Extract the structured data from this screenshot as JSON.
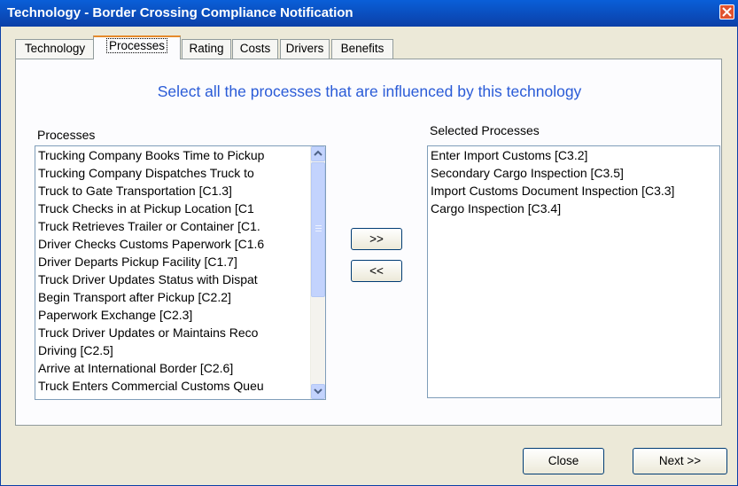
{
  "window": {
    "title": "Technology - Border Crossing Compliance Notification"
  },
  "tabs": [
    {
      "label": "Technology",
      "active": false
    },
    {
      "label": "Processes",
      "active": true
    },
    {
      "label": "Rating",
      "active": false
    },
    {
      "label": "Costs",
      "active": false
    },
    {
      "label": "Drivers",
      "active": false
    },
    {
      "label": "Benefits",
      "active": false
    }
  ],
  "main": {
    "instruction": "Select all the processes that are influenced by this technology",
    "processes_label": "Processes",
    "selected_label": "Selected Processes",
    "add_button": ">>",
    "remove_button": "<<",
    "processes": [
      "Trucking Company Books Time to Pickup",
      "Trucking Company Dispatches Truck to",
      "Truck to Gate Transportation [C1.3]",
      "Truck Checks in at Pickup Location [C1",
      "Truck Retrieves Trailer or Container [C1.",
      "Driver Checks Customs Paperwork [C1.6",
      "Driver Departs Pickup Facility [C1.7]",
      "Truck Driver Updates Status with Dispat",
      "Begin Transport after Pickup [C2.2]",
      "Paperwork Exchange [C2.3]",
      "Truck Driver Updates or Maintains Reco",
      "Driving [C2.5]",
      "Arrive at International Border [C2.6]",
      "Truck Enters Commercial Customs Queu"
    ],
    "selected": [
      "Enter Import Customs [C3.2]",
      "Secondary Cargo Inspection [C3.5]",
      "Import Customs Document Inspection [C3.3]",
      "Cargo Inspection [C3.4]"
    ]
  },
  "footer": {
    "close_label": "Close",
    "next_label": "Next >>"
  },
  "colors": {
    "title_bar": "#0b4fc4",
    "instruction_text": "#2a5bd7",
    "active_tab_accent": "#e68b2c"
  }
}
